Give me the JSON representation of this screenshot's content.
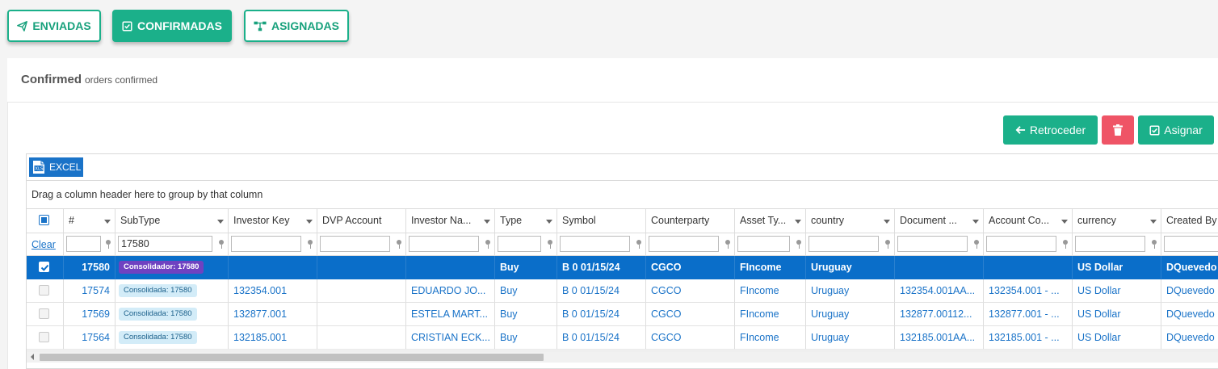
{
  "tabs": [
    {
      "label": "ENVIADAS",
      "icon": "paper-plane-icon",
      "active": false
    },
    {
      "label": "CONFIRMADAS",
      "icon": "check-square-icon",
      "active": true
    },
    {
      "label": "ASIGNADAS",
      "icon": "sitemap-icon",
      "active": false
    }
  ],
  "header": {
    "title": "Confirmed",
    "subtitle": "orders confirmed"
  },
  "actions": {
    "back_label": "Retroceder",
    "delete_icon": "trash-icon",
    "assign_label": "Asignar"
  },
  "toolbar": {
    "excel_label": "EXCEL"
  },
  "grid": {
    "group_hint": "Drag a column header here to group by that column",
    "clear_label": "Clear",
    "columns": [
      "#",
      "SubType",
      "Investor Key",
      "DVP Account",
      "Investor Na...",
      "Type",
      "Symbol",
      "Counterparty",
      "Asset Ty...",
      "country",
      "Document ...",
      "Account Co...",
      "currency",
      "Created By"
    ],
    "filters": {
      "subtype": "17580"
    },
    "rows": [
      {
        "selected": true,
        "num": "17580",
        "subtype": "Consolidador: 17580",
        "investor_key": "",
        "dvp": "",
        "investor_name": "",
        "type": "Buy",
        "symbol": "B 0 01/15/24",
        "counterparty": "CGCO",
        "asset_type": "FIncome",
        "country": "Uruguay",
        "document": "",
        "account": "",
        "currency": "US Dollar",
        "created_by": "DQuevedo"
      },
      {
        "selected": false,
        "num": "17574",
        "subtype": "Consolidada: 17580",
        "investor_key": "132354.001",
        "dvp": "",
        "investor_name": "EDUARDO JO...",
        "type": "Buy",
        "symbol": "B 0 01/15/24",
        "counterparty": "CGCO",
        "asset_type": "FIncome",
        "country": "Uruguay",
        "document": "132354.001AA...",
        "account": "132354.001 - ...",
        "currency": "US Dollar",
        "created_by": "DQuevedo"
      },
      {
        "selected": false,
        "num": "17569",
        "subtype": "Consolidada: 17580",
        "investor_key": "132877.001",
        "dvp": "",
        "investor_name": "ESTELA MART...",
        "type": "Buy",
        "symbol": "B 0 01/15/24",
        "counterparty": "CGCO",
        "asset_type": "FIncome",
        "country": "Uruguay",
        "document": "132877.00112...",
        "account": "132877.001 - ...",
        "currency": "US Dollar",
        "created_by": "DQuevedo"
      },
      {
        "selected": false,
        "num": "17564",
        "subtype": "Consolidada: 17580",
        "investor_key": "132185.001",
        "dvp": "",
        "investor_name": "CRISTIAN ECK...",
        "type": "Buy",
        "symbol": "B 0 01/15/24",
        "counterparty": "CGCO",
        "asset_type": "FIncome",
        "country": "Uruguay",
        "document": "132185.001AA...",
        "account": "132185.001 - ...",
        "currency": "US Dollar",
        "created_by": "DQuevedo"
      }
    ]
  },
  "colors": {
    "accent": "#1bb08a",
    "danger": "#ef5466",
    "selection": "#0a6ec9",
    "badge_selected": "#6f42c1",
    "badge_normal": "#d3ecf8",
    "link": "#1a73c8"
  }
}
